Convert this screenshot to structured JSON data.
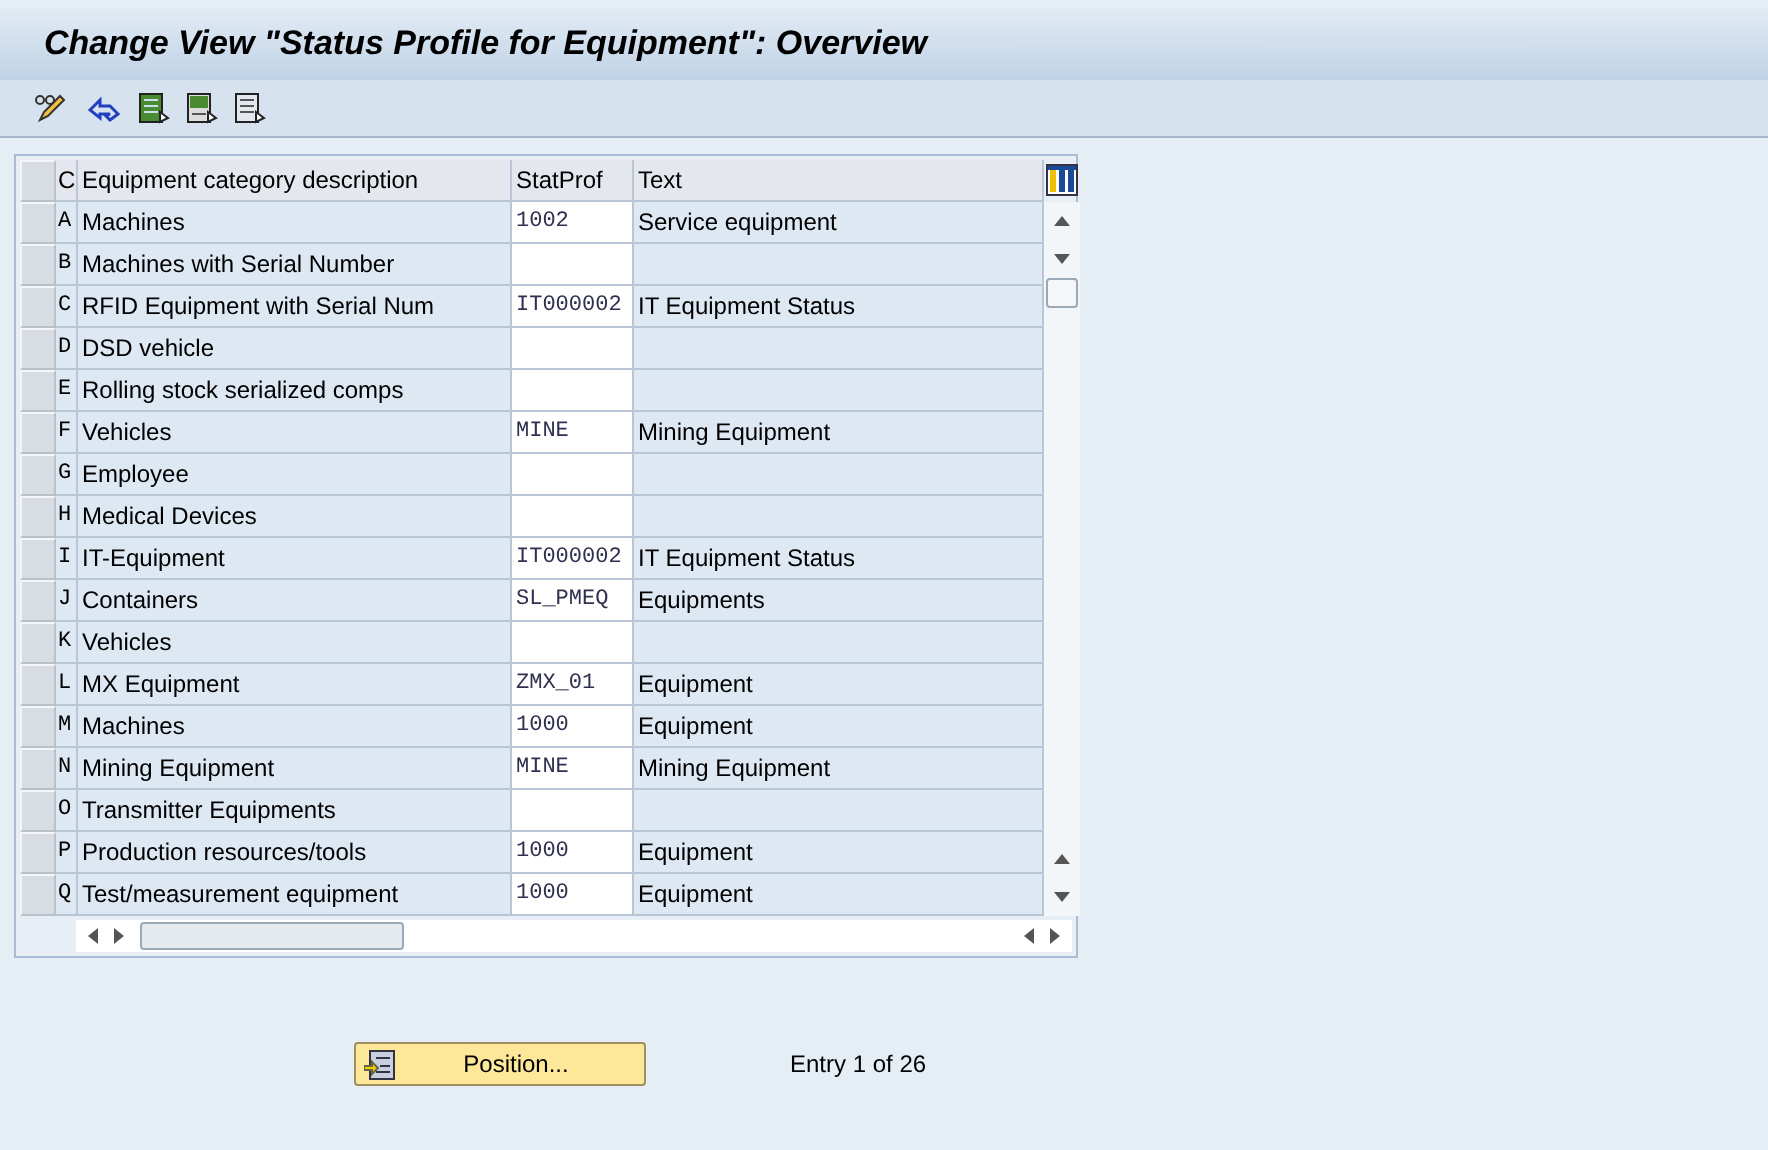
{
  "window": {
    "title": "Change View \"Status Profile for Equipment\": Overview"
  },
  "table": {
    "columns": [
      "C",
      "Equipment category description",
      "StatProf",
      "Text"
    ],
    "rows": [
      {
        "code": "A",
        "description": "Machines",
        "stat_prof": "1002",
        "text": "Service equipment"
      },
      {
        "code": "B",
        "description": "Machines with Serial Number"
      },
      {
        "code": "C",
        "description": "RFID Equipment with Serial Num",
        "stat_prof": "IT000002",
        "text": "IT Equipment Status"
      },
      {
        "code": "D",
        "description": "DSD vehicle"
      },
      {
        "code": "E",
        "description": "Rolling stock serialized comps"
      },
      {
        "code": "F",
        "description": "Vehicles",
        "stat_prof": "MINE",
        "text": "Mining Equipment"
      },
      {
        "code": "G",
        "description": "Employee"
      },
      {
        "code": "H",
        "description": "Medical Devices"
      },
      {
        "code": "I",
        "description": "IT-Equipment",
        "stat_prof": "IT000002",
        "text": "IT Equipment Status"
      },
      {
        "code": "J",
        "description": "Containers",
        "stat_prof": "SL_PMEQ",
        "text": "Equipments"
      },
      {
        "code": "K",
        "description": "Vehicles"
      },
      {
        "code": "L",
        "description": "MX Equipment",
        "stat_prof": "ZMX_01",
        "text": "Equipment"
      },
      {
        "code": "M",
        "description": "Machines",
        "stat_prof": "1000",
        "text": "Equipment"
      },
      {
        "code": "N",
        "description": "Mining Equipment",
        "stat_prof": "MINE",
        "text": "Mining Equipment"
      },
      {
        "code": "O",
        "description": "Transmitter Equipments"
      },
      {
        "code": "P",
        "description": "Production resources/tools",
        "stat_prof": "1000",
        "text": "Equipment"
      },
      {
        "code": "Q",
        "description": "Test/measurement equipment",
        "stat_prof": "1000",
        "text": "Equipment"
      }
    ]
  },
  "position_button": {
    "label": "Position..."
  },
  "entry_info": "Entry 1 of 26"
}
